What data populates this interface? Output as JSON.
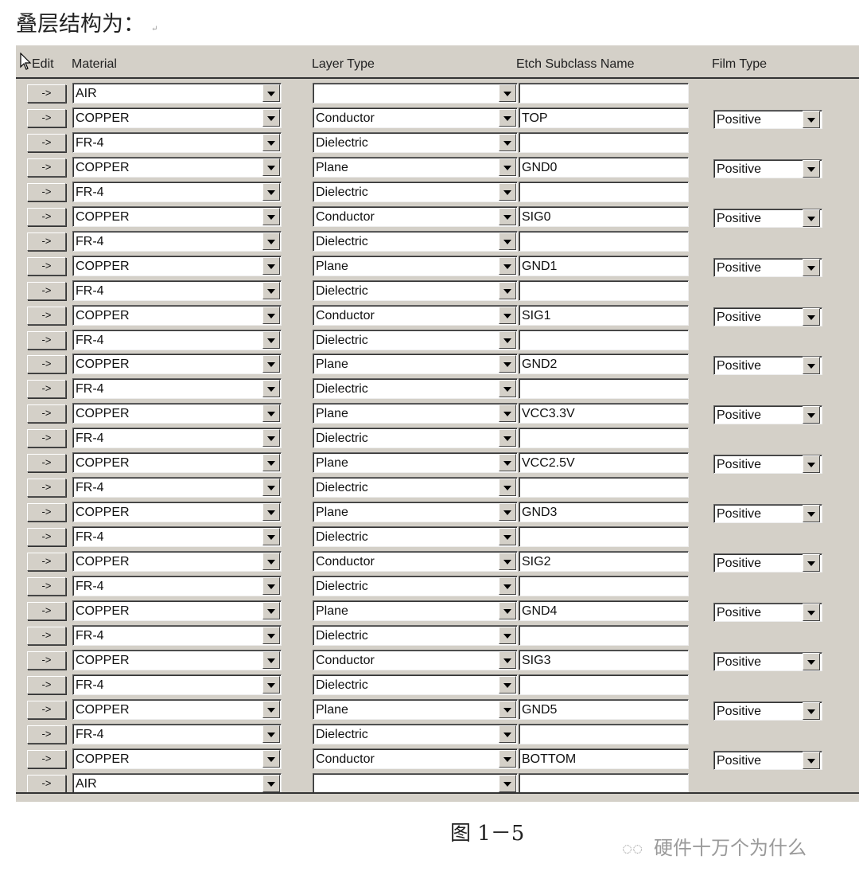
{
  "heading": "叠层结构为：",
  "paragraph_mark": "↵",
  "columns": {
    "edit": "Edit",
    "material": "Material",
    "layer_type": "Layer Type",
    "etch": "Etch Subclass Name",
    "film": "Film Type"
  },
  "arrow_label": "->",
  "rows": [
    {
      "material": "AIR",
      "layer_type": "",
      "etch": "",
      "film": null
    },
    {
      "material": "COPPER",
      "layer_type": "Conductor",
      "etch": "TOP",
      "film": "Positive"
    },
    {
      "material": "FR-4",
      "layer_type": "Dielectric",
      "etch": "",
      "film": null
    },
    {
      "material": "COPPER",
      "layer_type": "Plane",
      "etch": "GND0",
      "film": "Positive"
    },
    {
      "material": "FR-4",
      "layer_type": "Dielectric",
      "etch": "",
      "film": null
    },
    {
      "material": "COPPER",
      "layer_type": "Conductor",
      "etch": "SIG0",
      "film": "Positive"
    },
    {
      "material": "FR-4",
      "layer_type": "Dielectric",
      "etch": "",
      "film": null
    },
    {
      "material": "COPPER",
      "layer_type": "Plane",
      "etch": "GND1",
      "film": "Positive"
    },
    {
      "material": "FR-4",
      "layer_type": "Dielectric",
      "etch": "",
      "film": null
    },
    {
      "material": "COPPER",
      "layer_type": "Conductor",
      "etch": "SIG1",
      "film": "Positive"
    },
    {
      "material": "FR-4",
      "layer_type": "Dielectric",
      "etch": "",
      "film": null
    },
    {
      "material": "COPPER",
      "layer_type": "Plane",
      "etch": "GND2",
      "film": "Positive"
    },
    {
      "material": "FR-4",
      "layer_type": "Dielectric",
      "etch": "",
      "film": null
    },
    {
      "material": "COPPER",
      "layer_type": "Plane",
      "etch": "VCC3.3V",
      "film": "Positive"
    },
    {
      "material": "FR-4",
      "layer_type": "Dielectric",
      "etch": "",
      "film": null
    },
    {
      "material": "COPPER",
      "layer_type": "Plane",
      "etch": "VCC2.5V",
      "film": "Positive"
    },
    {
      "material": "FR-4",
      "layer_type": "Dielectric",
      "etch": "",
      "film": null
    },
    {
      "material": "COPPER",
      "layer_type": "Plane",
      "etch": "GND3",
      "film": "Positive"
    },
    {
      "material": "FR-4",
      "layer_type": "Dielectric",
      "etch": "",
      "film": null
    },
    {
      "material": "COPPER",
      "layer_type": "Conductor",
      "etch": "SIG2",
      "film": "Positive"
    },
    {
      "material": "FR-4",
      "layer_type": "Dielectric",
      "etch": "",
      "film": null
    },
    {
      "material": "COPPER",
      "layer_type": "Plane",
      "etch": "GND4",
      "film": "Positive"
    },
    {
      "material": "FR-4",
      "layer_type": "Dielectric",
      "etch": "",
      "film": null
    },
    {
      "material": "COPPER",
      "layer_type": "Conductor",
      "etch": "SIG3",
      "film": "Positive"
    },
    {
      "material": "FR-4",
      "layer_type": "Dielectric",
      "etch": "",
      "film": null
    },
    {
      "material": "COPPER",
      "layer_type": "Plane",
      "etch": "GND5",
      "film": "Positive"
    },
    {
      "material": "FR-4",
      "layer_type": "Dielectric",
      "etch": "",
      "film": null
    },
    {
      "material": "COPPER",
      "layer_type": "Conductor",
      "etch": "BOTTOM",
      "film": "Positive"
    },
    {
      "material": "AIR",
      "layer_type": "",
      "etch": "",
      "film": null
    }
  ],
  "caption": "图 1－5",
  "watermark": "硬件十万个为什么",
  "watermark_icon": "wechat-icon"
}
